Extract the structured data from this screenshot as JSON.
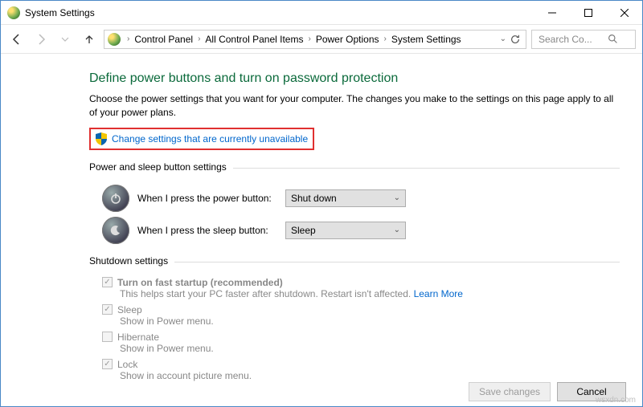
{
  "window": {
    "title": "System Settings"
  },
  "breadcrumb": {
    "items": [
      "Control Panel",
      "All Control Panel Items",
      "Power Options",
      "System Settings"
    ]
  },
  "search": {
    "placeholder": "Search Co..."
  },
  "page": {
    "title": "Define power buttons and turn on password protection",
    "description": "Choose the power settings that you want for your computer. The changes you make to the settings on this page apply to all of your power plans.",
    "change_link": "Change settings that are currently unavailable"
  },
  "power_group": {
    "label": "Power and sleep button settings",
    "rows": [
      {
        "label": "When I press the power button:",
        "value": "Shut down"
      },
      {
        "label": "When I press the sleep button:",
        "value": "Sleep"
      }
    ]
  },
  "shutdown_group": {
    "label": "Shutdown settings",
    "items": [
      {
        "title": "Turn on fast startup (recommended)",
        "checked": true,
        "desc_pre": "This helps start your PC faster after shutdown. Restart isn't affected. ",
        "learn_more": "Learn More",
        "bold": true
      },
      {
        "title": "Sleep",
        "checked": true,
        "desc_pre": "Show in Power menu.",
        "learn_more": "",
        "bold": false
      },
      {
        "title": "Hibernate",
        "checked": false,
        "desc_pre": "Show in Power menu.",
        "learn_more": "",
        "bold": false
      },
      {
        "title": "Lock",
        "checked": true,
        "desc_pre": "Show in account picture menu.",
        "learn_more": "",
        "bold": false
      }
    ]
  },
  "footer": {
    "save": "Save changes",
    "cancel": "Cancel"
  },
  "watermark": "wsxdn.com"
}
